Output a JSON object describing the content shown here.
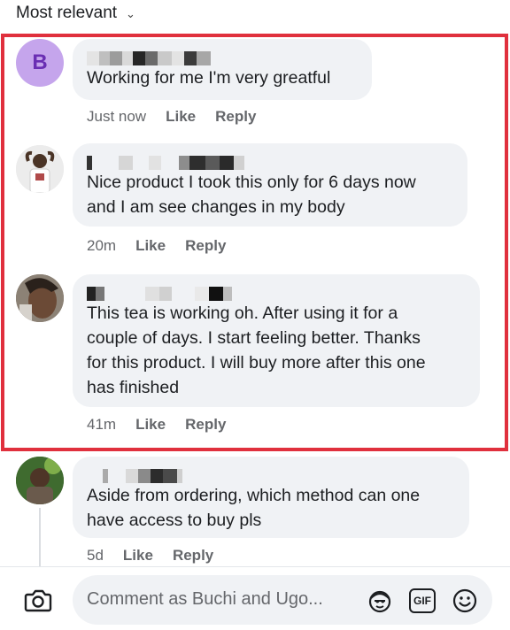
{
  "sort": {
    "label": "Most relevant",
    "chevron": "chevron-down-icon"
  },
  "comments": [
    {
      "avatar_letter": "B",
      "lines": [
        "Working for me I'm very greatful"
      ],
      "time": "Just now",
      "like": "Like",
      "reply": "Reply"
    },
    {
      "lines": [
        "Nice product I took this only for 6 days now",
        "and I am see changes in my body"
      ],
      "time": "20m",
      "like": "Like",
      "reply": "Reply"
    },
    {
      "lines": [
        "This tea is working oh. After using it for a",
        "couple of days. I start feeling better. Thanks",
        "for this product. I will buy more after this one",
        "has finished"
      ],
      "time": "41m",
      "like": "Like",
      "reply": "Reply"
    },
    {
      "lines": [
        "Aside from ordering, which method can one",
        "have access to buy pls"
      ],
      "time": "5d",
      "like": "Like",
      "reply": "Reply"
    }
  ],
  "composer": {
    "placeholder": "Comment as Buchi and Ugo...",
    "gif_label": "GIF",
    "icons": [
      "camera-icon",
      "avatar-sticker-icon",
      "gif-icon",
      "emoji-icon"
    ]
  },
  "colors": {
    "highlight": "#e0303d",
    "bubble": "#f0f2f5",
    "meta": "#65676b"
  }
}
